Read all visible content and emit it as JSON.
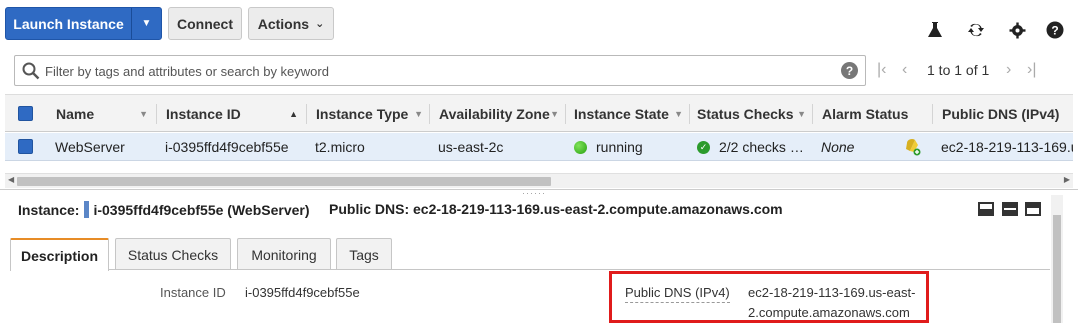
{
  "toolbar": {
    "launch_label": "Launch Instance",
    "launch_dropdown_icon": "caret-down-icon",
    "connect_label": "Connect",
    "actions_label": "Actions",
    "actions_caret": "⌄",
    "icons": [
      "flask-icon",
      "refresh-icon",
      "gear-icon",
      "help-icon"
    ]
  },
  "search": {
    "placeholder": "Filter by tags and attributes or search by keyword",
    "value": ""
  },
  "pager": {
    "text": "1 to 1 of 1"
  },
  "table": {
    "columns": [
      {
        "label": "Name"
      },
      {
        "label": "Instance ID"
      },
      {
        "label": "Instance Type"
      },
      {
        "label": "Availability Zone"
      },
      {
        "label": "Instance State"
      },
      {
        "label": "Status Checks"
      },
      {
        "label": "Alarm Status"
      },
      {
        "label": "Public DNS (IPv4)"
      }
    ],
    "rows": [
      {
        "name": "WebServer",
        "instance_id": "i-0395ffd4f9cebf55e",
        "instance_type": "t2.micro",
        "availability_zone": "us-east-2c",
        "instance_state": "running",
        "status_checks": "2/2 checks …",
        "alarm_status": "None",
        "public_dns": "ec2-18-219-113-169.u"
      }
    ]
  },
  "detail": {
    "instance_label": "Instance:",
    "instance_value": "i-0395ffd4f9cebf55e (WebServer)",
    "public_dns_label": "Public DNS:",
    "public_dns_value": "ec2-18-219-113-169.us-east-2.compute.amazonaws.com",
    "tabs": [
      "Description",
      "Status Checks",
      "Monitoring",
      "Tags"
    ],
    "active_tab": "Description",
    "fields": {
      "instance_id_label": "Instance ID",
      "instance_id_value": "i-0395ffd4f9cebf55e",
      "public_dns_label": "Public DNS (IPv4)",
      "public_dns_line1": "ec2-18-219-113-169.us-east-",
      "public_dns_line2": "2.compute.amazonaws.com"
    }
  },
  "colors": {
    "primary_button": "#2f6ac3",
    "selected_row": "#e5eef9",
    "active_tab_accent": "#e78c26",
    "highlight_box": "#e01b1b",
    "running_green": "#27a010"
  }
}
